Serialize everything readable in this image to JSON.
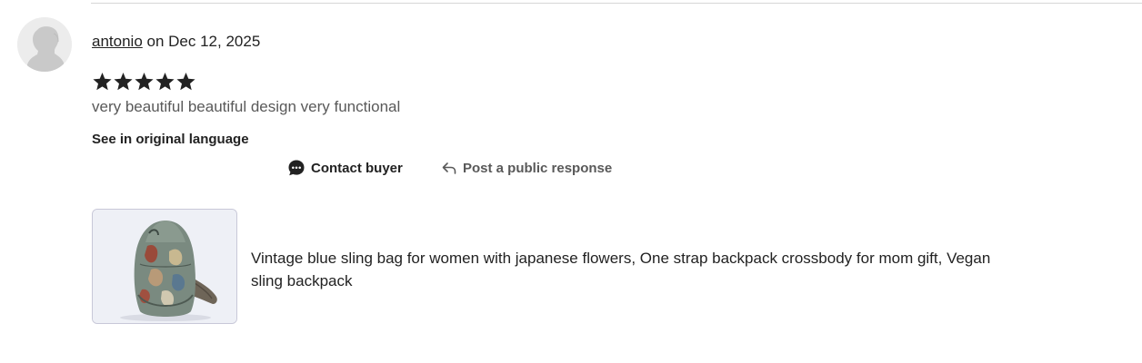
{
  "review": {
    "reviewer_name": "antonio",
    "date_text": "on Dec 12, 2025",
    "rating": 5,
    "rating_max": 5,
    "text": "very beautiful beautiful design very functional",
    "translate_label": "See in original language"
  },
  "actions": {
    "contact_label": "Contact buyer",
    "respond_label": "Post a public response"
  },
  "product": {
    "title": "Vintage blue sling bag for women with japanese flowers, One strap backpack crossbody for mom gift, Vegan sling backpack"
  },
  "icons": {
    "avatar": "default-user-avatar-icon",
    "star": "star-icon",
    "contact": "chat-bubble-icon",
    "respond": "reply-arrow-icon"
  },
  "colors": {
    "text_primary": "#222222",
    "text_secondary": "#595959",
    "star": "#222222",
    "divider": "#d6d6d6"
  }
}
